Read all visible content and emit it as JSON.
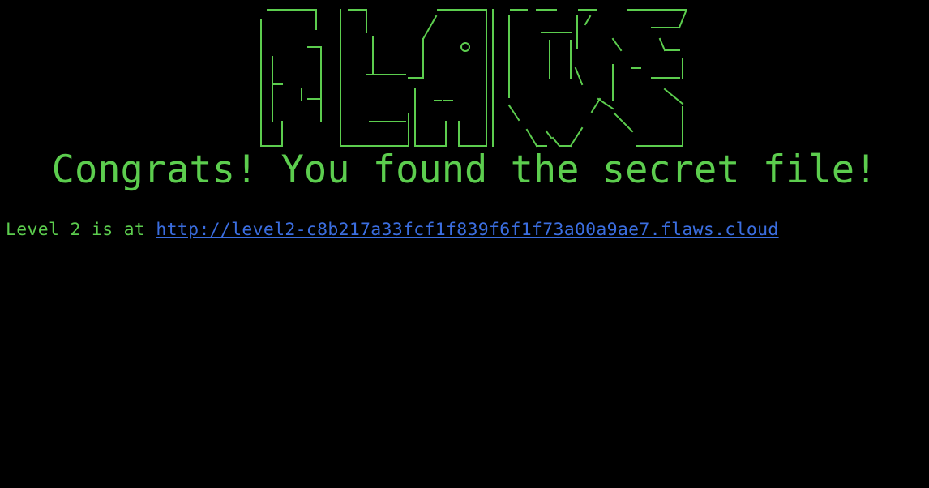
{
  "banner": {
    "logo_text": "FLAWS",
    "color": "#5ccd4e"
  },
  "congrats_text": "Congrats! You found the secret file!",
  "level": {
    "prefix": "Level 2 is at ",
    "link_text": "http://level2-c8b217a33fcf1f839f6f1f73a00a9ae7.flaws.cloud"
  },
  "colors": {
    "background": "#000000",
    "text": "#5ccd4e",
    "link": "#3b6ee0"
  }
}
